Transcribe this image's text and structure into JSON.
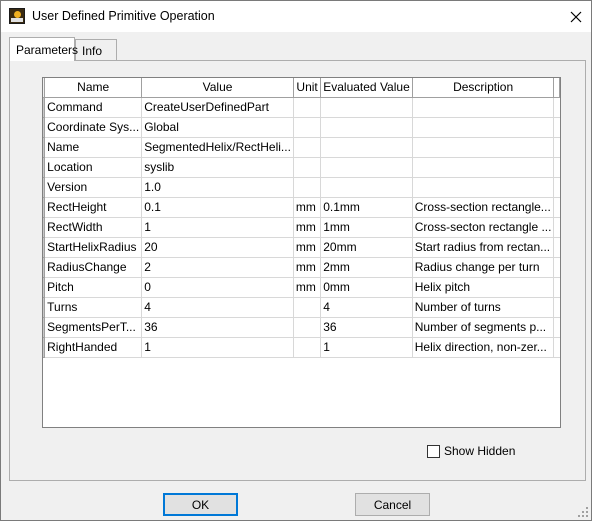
{
  "window": {
    "title": "User Defined Primitive Operation",
    "icon": "app-icon"
  },
  "tabs": [
    {
      "label": "Parameters",
      "active": true
    },
    {
      "label": "Info",
      "active": false
    }
  ],
  "grid": {
    "columns": [
      "Name",
      "Value",
      "Unit",
      "Evaluated Value",
      "Description"
    ],
    "rows": [
      {
        "name": "Command",
        "value": "CreateUserDefinedPart",
        "unit": "",
        "evaluated": "",
        "description": ""
      },
      {
        "name": "Coordinate Sys...",
        "value": "Global",
        "unit": "",
        "evaluated": "",
        "description": ""
      },
      {
        "name": "Name",
        "value": "SegmentedHelix/RectHeli...",
        "unit": "",
        "evaluated": "",
        "description": ""
      },
      {
        "name": "Location",
        "value": "syslib",
        "unit": "",
        "evaluated": "",
        "description": ""
      },
      {
        "name": "Version",
        "value": "1.0",
        "unit": "",
        "evaluated": "",
        "description": ""
      },
      {
        "name": "RectHeight",
        "value": "0.1",
        "unit": "mm",
        "evaluated": "0.1mm",
        "description": "Cross-section rectangle..."
      },
      {
        "name": "RectWidth",
        "value": "1",
        "unit": "mm",
        "evaluated": "1mm",
        "description": "Cross-secton rectangle ..."
      },
      {
        "name": "StartHelixRadius",
        "value": "20",
        "unit": "mm",
        "evaluated": "20mm",
        "description": "Start radius from rectan..."
      },
      {
        "name": "RadiusChange",
        "value": "2",
        "unit": "mm",
        "evaluated": "2mm",
        "description": "Radius change per turn"
      },
      {
        "name": "Pitch",
        "value": "0",
        "unit": "mm",
        "evaluated": "0mm",
        "description": "Helix pitch"
      },
      {
        "name": "Turns",
        "value": "4",
        "unit": "",
        "evaluated": "4",
        "description": "Number of turns"
      },
      {
        "name": "SegmentsPerT...",
        "value": "36",
        "unit": "",
        "evaluated": "36",
        "description": "Number of segments p..."
      },
      {
        "name": "RightHanded",
        "value": "1",
        "unit": "",
        "evaluated": "1",
        "description": "Helix direction, non-zer..."
      }
    ]
  },
  "show_hidden": {
    "label": "Show Hidden",
    "checked": false
  },
  "buttons": {
    "ok": "OK",
    "cancel": "Cancel"
  },
  "colors": {
    "focus_border": "#0078d7",
    "window_bg": "#f0f0f0"
  }
}
